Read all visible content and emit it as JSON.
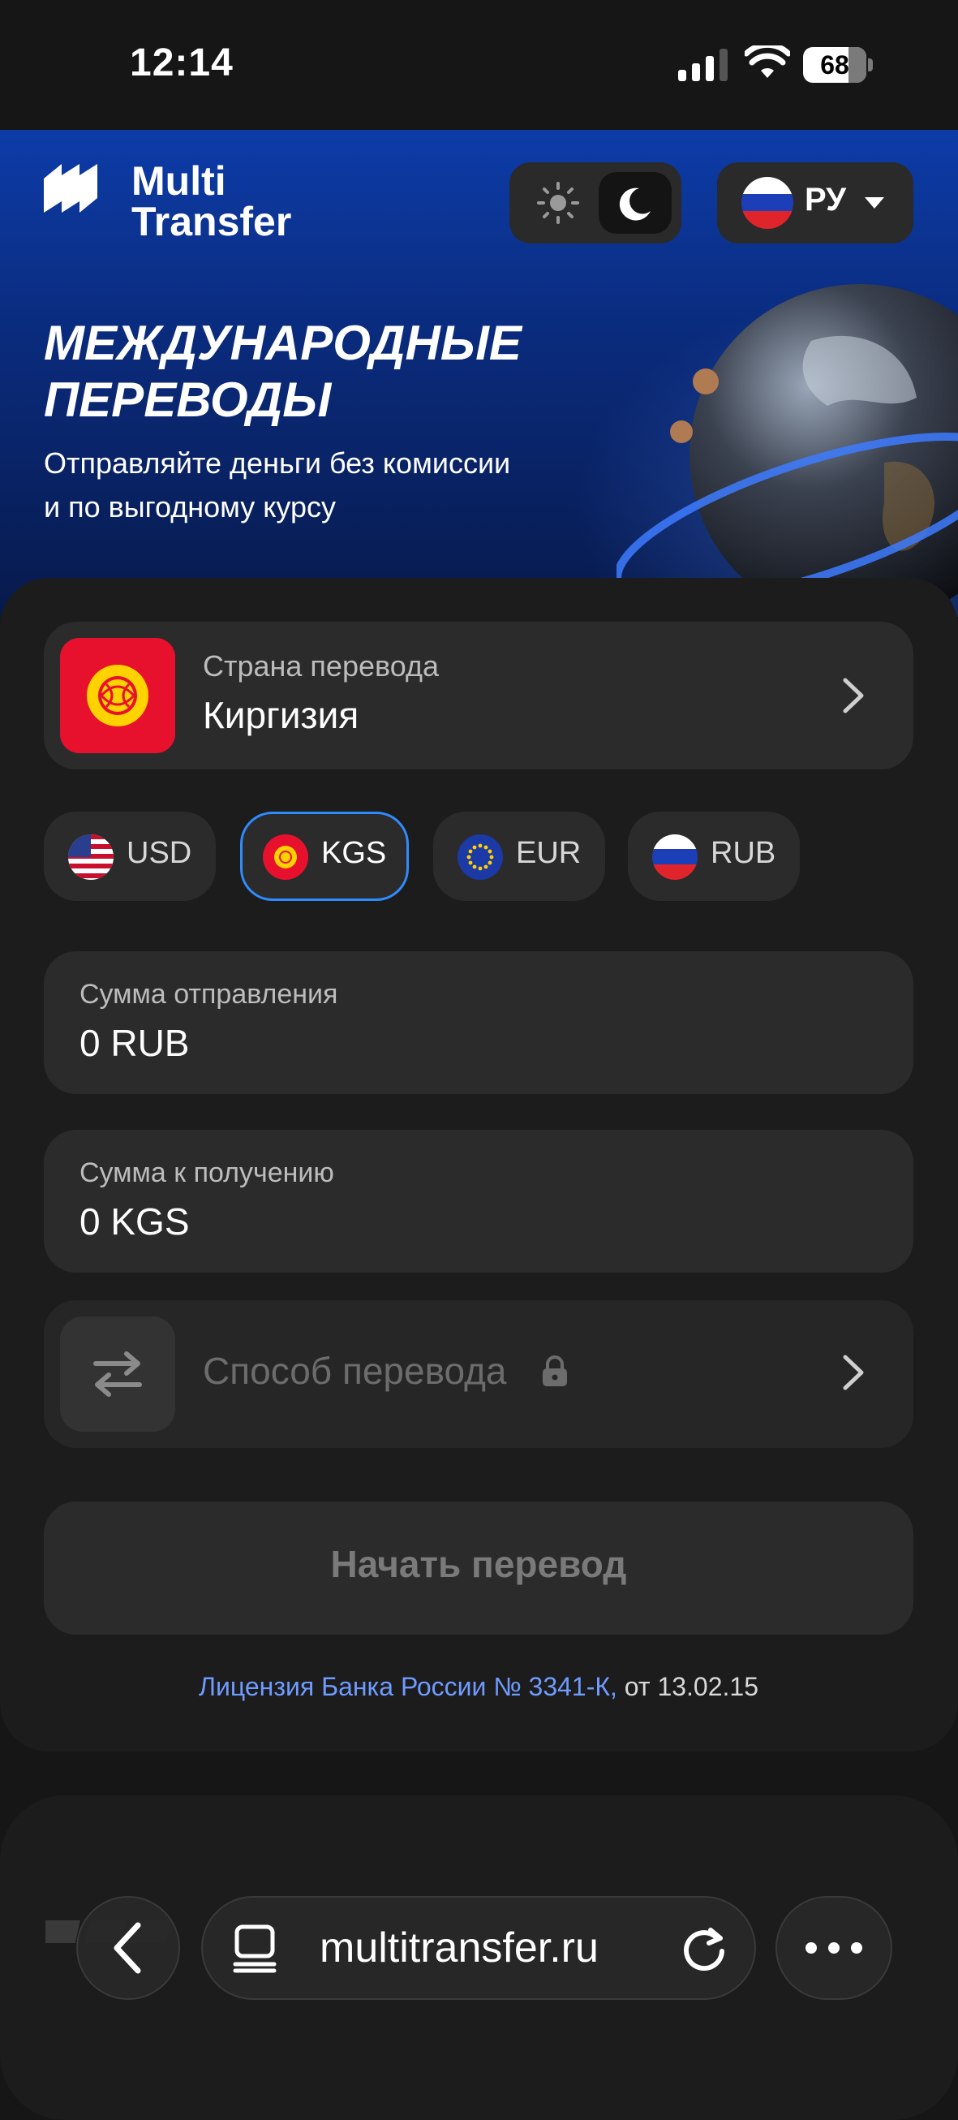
{
  "status_bar": {
    "time": "12:14",
    "battery": "68"
  },
  "header": {
    "logo_line1": "Multi",
    "logo_line2": "Transfer",
    "language": "РУ"
  },
  "hero": {
    "title_line1": "МЕЖДУНАРОДНЫЕ",
    "title_line2": "ПЕРЕВОДЫ",
    "subtitle_line1": "Отправляйте деньги без комиссии",
    "subtitle_line2": "и по выгодному курсу"
  },
  "form": {
    "country_label": "Страна перевода",
    "country_value": "Киргизия",
    "currencies": [
      {
        "code": "USD",
        "selected": false
      },
      {
        "code": "KGS",
        "selected": true
      },
      {
        "code": "EUR",
        "selected": false
      },
      {
        "code": "RUB",
        "selected": false
      }
    ],
    "send_label": "Сумма отправления",
    "send_value": "0 RUB",
    "receive_label": "Сумма к получению",
    "receive_value": "0 KGS",
    "method_label": "Способ перевода",
    "start_button": "Начать перевод",
    "license_link": "Лицензия Банка России № 3341-К,",
    "license_date": " от 13.02.15"
  },
  "browser": {
    "url": "multitransfer.ru"
  },
  "colors": {
    "accent": "#2f8cff",
    "link": "#6f9bff",
    "card": "#1c1c1c",
    "field": "#2b2b2b",
    "kyrgyz_red": "#e8112d"
  }
}
